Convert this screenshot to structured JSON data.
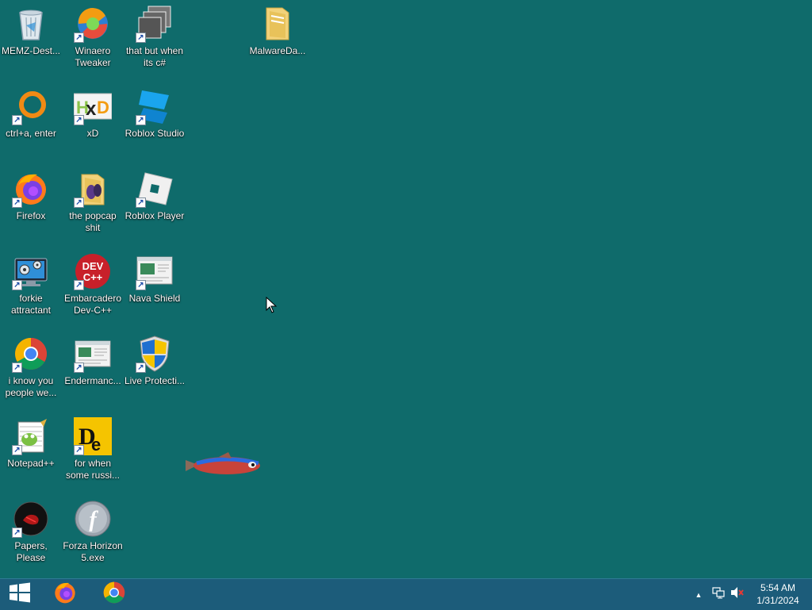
{
  "desktop": {
    "icons": [
      {
        "label": "MEMZ-Dest...",
        "icon": "recycle-bin-icon"
      },
      {
        "label": "Winaero Tweaker",
        "icon": "winaero-tweaker-icon"
      },
      {
        "label": "that but when its c#",
        "icon": "stacked-windows-icon"
      },
      {
        "label": "MalwareDa...",
        "icon": "folder-icon"
      },
      {
        "label": "ctrl+a, enter",
        "icon": "orange-ring-icon"
      },
      {
        "label": "xD",
        "icon": "hxd-icon"
      },
      {
        "label": "Roblox Studio",
        "icon": "roblox-studio-icon"
      },
      {
        "label": "Firefox",
        "icon": "firefox-icon"
      },
      {
        "label": "the popcap shit",
        "icon": "folder-icon"
      },
      {
        "label": "Roblox Player",
        "icon": "roblox-player-icon"
      },
      {
        "label": "forkie attractant",
        "icon": "computer-settings-icon"
      },
      {
        "label": "Embarcadero Dev-C++",
        "icon": "dev-cpp-icon"
      },
      {
        "label": "Nava Shield",
        "icon": "window-app-icon"
      },
      {
        "label": "i know you people we...",
        "icon": "chrome-icon"
      },
      {
        "label": "Endermanc...",
        "icon": "window-app-icon"
      },
      {
        "label": "Live Protecti...",
        "icon": "security-shield-icon"
      },
      {
        "label": "Notepad++",
        "icon": "notepad-plus-plus-icon"
      },
      {
        "label": "for when some russi...",
        "icon": "de-app-icon"
      },
      {
        "label": "Papers, Please",
        "icon": "papers-please-icon"
      },
      {
        "label": "Forza Horizon 5.exe",
        "icon": "flash-icon"
      }
    ]
  },
  "taskbar": {
    "start": "windows-logo-icon",
    "pinned": [
      "firefox-icon",
      "chrome-icon"
    ],
    "tray_arrow": "▲",
    "time": "5:54 AM",
    "date": "1/31/2024"
  },
  "colors": {
    "desktop": "#0f6b6b",
    "taskbar": "#1c5c7a"
  }
}
